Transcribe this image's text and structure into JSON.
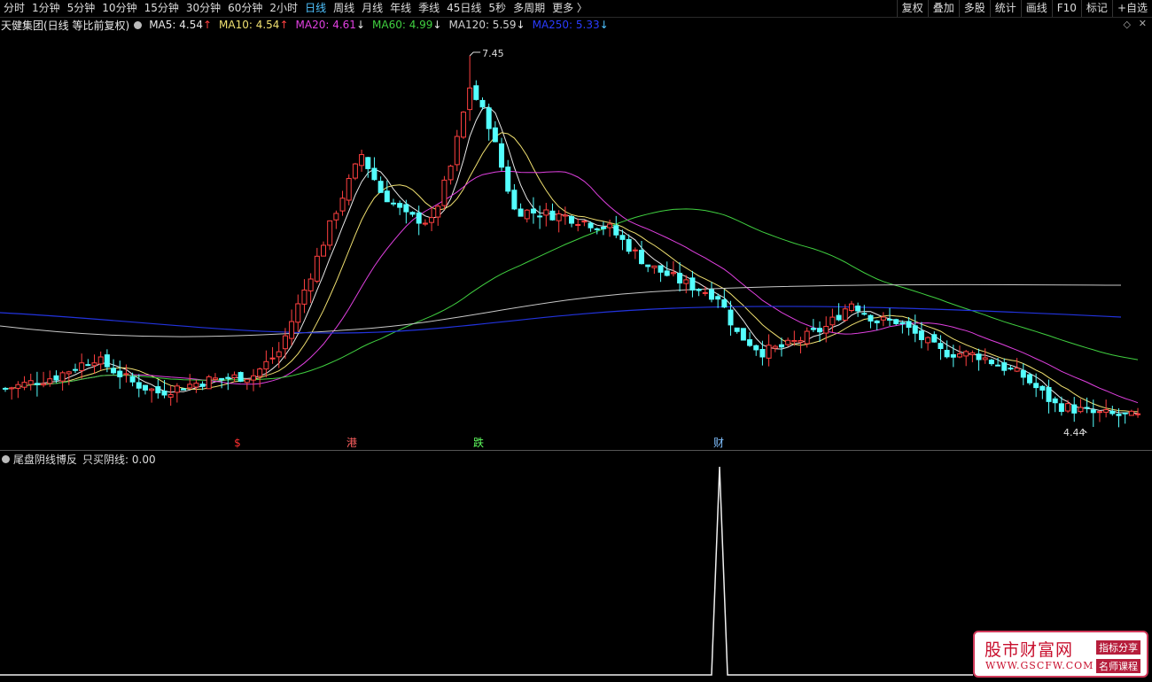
{
  "toolbar": {
    "period_tabs": [
      "分时",
      "1分钟",
      "5分钟",
      "10分钟",
      "15分钟",
      "30分钟",
      "60分钟",
      "2小时",
      "日线",
      "周线",
      "月线",
      "年线",
      "季线",
      "45日线",
      "5秒",
      "多周期",
      "更多"
    ],
    "active_tab": 8,
    "more_arrow": "〉",
    "right_tools": [
      "复权",
      "叠加",
      "多股",
      "统计",
      "画线",
      "F10",
      "标记",
      "+自选"
    ]
  },
  "chart_header": {
    "title": "天健集团(日线 等比前复权)",
    "indicators": [
      {
        "label": "MA5: 4.54",
        "arrow": "↑",
        "color": "#e8e8e8",
        "arrow_color": "#ff4040"
      },
      {
        "label": "MA10: 4.54",
        "arrow": "↑",
        "color": "#f0e070",
        "arrow_color": "#ff4040"
      },
      {
        "label": "MA20: 4.61",
        "arrow": "↓",
        "color": "#e040e0",
        "arrow_color": "#e8e8e8"
      },
      {
        "label": "MA60: 4.99",
        "arrow": "↓",
        "color": "#40d040",
        "arrow_color": "#e8e8e8"
      },
      {
        "label": "MA120: 5.59",
        "arrow": "↓",
        "color": "#d0d0d0",
        "arrow_color": "#e8e8e8"
      },
      {
        "label": "MA250: 5.33",
        "arrow": "↓",
        "color": "#2a3cff",
        "arrow_color": "#4fc3ff"
      }
    ]
  },
  "annotations": {
    "high_label": "7.45",
    "low_label": "4.44",
    "markers": [
      {
        "text": "$",
        "color": "#ff3030"
      },
      {
        "text": "港",
        "color": "#ff6060"
      },
      {
        "text": "跌",
        "color": "#60ff60"
      },
      {
        "text": "财",
        "color": "#80c0ff"
      }
    ]
  },
  "indicator_panel": {
    "title": "尾盘阴线博反",
    "value_label": "只买阴线: 0.00"
  },
  "colors": {
    "up": "#ff4040",
    "down": "#54ffff",
    "ma5": "#e8e8e8",
    "ma10": "#f0e070",
    "ma20": "#e040e0",
    "ma60": "#40d040",
    "ma120": "#c8c8c8",
    "ma250": "#2233dd"
  },
  "watermark": {
    "name": "股市财富网",
    "url": "WWW.GSCFW.COM",
    "tag1": "指标分享",
    "tag2": "名师课程"
  }
}
